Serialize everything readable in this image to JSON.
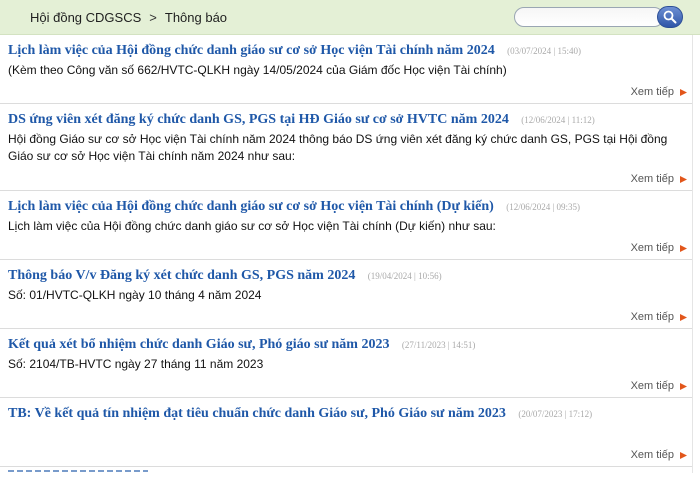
{
  "breadcrumb": {
    "items": [
      "Hội đồng CDGSCS",
      "Thông báo"
    ],
    "separator": ">"
  },
  "search": {
    "value": "",
    "placeholder": "",
    "button_icon": "search-icon"
  },
  "more_label": "Xem tiếp",
  "colors": {
    "title": "#1f58a8",
    "date": "#a9a9a9",
    "topbar": "#e4f0d6",
    "arrow": "#e2561b"
  },
  "announcements": [
    {
      "title": "Lịch làm việc của Hội đồng chức danh giáo sư cơ sở Học viện Tài chính năm 2024",
      "date": "(03/07/2024 | 15:40)",
      "description": "(Kèm theo Công văn số 662/HVTC-QLKH ngày 14/05/2024 của Giám đốc Học viện Tài chính)"
    },
    {
      "title": "DS ứng viên xét đăng ký chức danh GS, PGS tại HĐ Giáo sư cơ sở HVTC năm 2024",
      "date": "(12/06/2024 | 11:12)",
      "description": "Hội đồng Giáo sư cơ sở Học viện Tài chính năm 2024 thông báo DS ứng viên xét đăng ký chức danh GS, PGS tại Hội đồng Giáo sư cơ sở Học viện Tài chính năm 2024 như sau:"
    },
    {
      "title": "Lịch làm việc của Hội đồng chức danh giáo sư cơ sở Học viện Tài chính (Dự kiến)",
      "date": "(12/06/2024 | 09:35)",
      "description": "Lịch làm việc của Hội đồng chức danh giáo sư cơ sở Học viện Tài chính (Dự kiến) như sau:"
    },
    {
      "title": "Thông báo V/v Đăng ký xét chức danh GS, PGS năm 2024",
      "date": "(19/04/2024 | 10:56)",
      "description": "Số: 01/HVTC-QLKH ngày 10 tháng 4 năm 2024"
    },
    {
      "title": "Kết quả xét bổ nhiệm chức danh Giáo sư, Phó giáo sư năm 2023",
      "date": "(27/11/2023 | 14:51)",
      "description": "Số: 2104/TB-HVTC ngày 27 tháng 11 năm 2023"
    },
    {
      "title": "TB: Về kết quả tín nhiệm đạt tiêu chuẩn chức danh Giáo sư, Phó Giáo sư năm 2023",
      "date": "(20/07/2023 | 17:12)",
      "description": ""
    }
  ]
}
